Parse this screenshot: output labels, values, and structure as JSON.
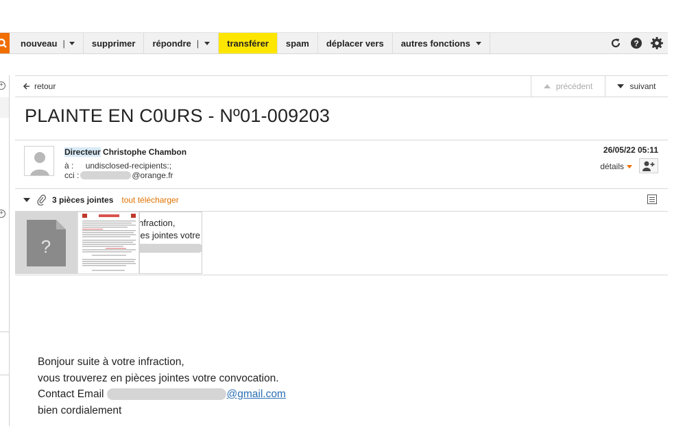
{
  "toolbar": {
    "nouveau": "nouveau",
    "nouveau_sep": "|",
    "supprimer": "supprimer",
    "repondre": "répondre",
    "repondre_sep": "|",
    "transferer": "transférer",
    "spam": "spam",
    "deplacer": "déplacer vers",
    "autres": "autres fonctions",
    "highlight_color": "#ffe600",
    "icons": [
      "search-icon",
      "refresh-icon",
      "help-icon",
      "gear-icon"
    ]
  },
  "nav": {
    "back": "retour",
    "previous": "précédent",
    "next": "suivant"
  },
  "message": {
    "subject": "PLAINTE EN C0URS - Nº01-009203",
    "sender_title": "Directeur",
    "sender_name": "Christophe Chambon",
    "to_label": "à :",
    "to_value": "undisclosed-recipients:;",
    "cc_label": "cci :",
    "cc_domain": "@orange.fr",
    "date": "26/05/22 05:11",
    "details": "détails"
  },
  "attachments": {
    "label": "3 pièces jointes",
    "download_all": "tout télécharger",
    "preview_line1": "nfraction,",
    "preview_line2": "ces jointes votre"
  },
  "body": {
    "line1": "Bonjour suite à votre infraction,",
    "line2": "vous trouverez en pièces jointes votre convocation.",
    "line3_label": "Contact Email",
    "line3_domain": "@gmail.com",
    "line4": "bien cordialement"
  },
  "colors": {
    "accent": "#f16e00",
    "link": "#2a6eb5"
  }
}
